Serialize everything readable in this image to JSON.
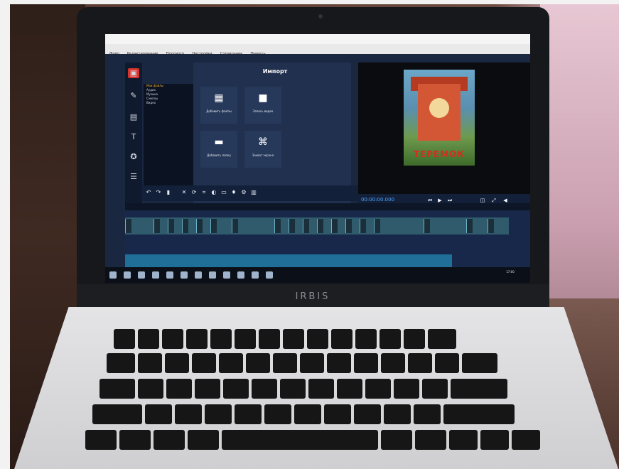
{
  "laptop": {
    "brand": "IRBIS"
  },
  "screen": {
    "menu_items": [
      "Файл",
      "Редактирование",
      "Просмотр",
      "Настройки",
      "Справочник",
      "Помощь"
    ],
    "import_title": "Импорт",
    "file_list": [
      "Мои файлы",
      "Аудио",
      "Музыка",
      "Сэмплы",
      "Видео"
    ],
    "tiles": [
      {
        "label": "Добавить файлы",
        "icon": "add-files-icon",
        "glyph": "▦"
      },
      {
        "label": "Запись видео",
        "icon": "record-video-icon",
        "glyph": "■"
      },
      {
        "label": "Добавить папку",
        "icon": "folder-icon",
        "glyph": "▬"
      },
      {
        "label": "Захват экрана",
        "icon": "screen-capture-icon",
        "glyph": "⌘"
      }
    ],
    "cover_title": "ТЕРЕМОК",
    "timecode": "00:00:00.000",
    "clock": "17:00",
    "accent": "#d9322a",
    "timeline_accent": "#4aa3ff"
  }
}
